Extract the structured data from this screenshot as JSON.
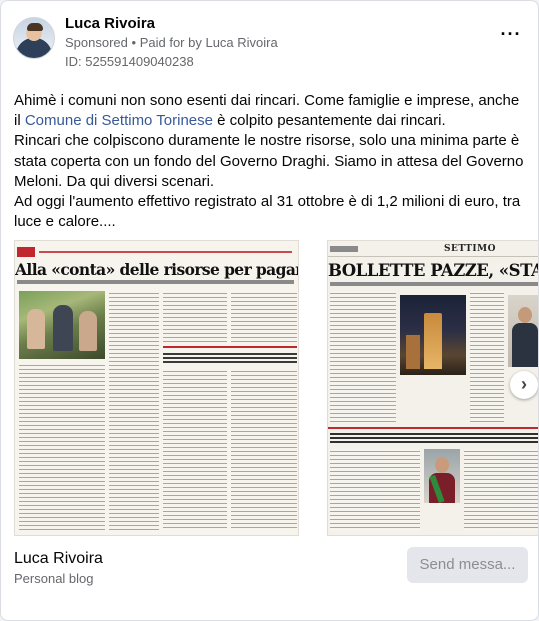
{
  "post": {
    "page_name": "Luca Rivoira",
    "sponsored_label": "Sponsored",
    "separator": "•",
    "paid_for_label": "Paid for by Luca Rivoira",
    "library_id": "ID: 525591409040238",
    "more_icon": "more-horizontal-icon",
    "body": {
      "part1": "Ahimè i comuni non sono esenti dai rincari. Come famiglie e imprese, anche il ",
      "link": "Comune di Settimo Torinese",
      "part2": " è colpito pesantemente dai rincari.",
      "line2": "Rincari che colpiscono duramente le nostre risorse, solo una minima parte è stata coperta con un fondo del Governo Draghi. Siamo in attesa del Governo Meloni. Da qui diversi scenari.",
      "line3": "Ad oggi l'aumento effettivo registrato al 31 ottobre è di 1,2 milioni di euro, tra luce e calore...."
    }
  },
  "carousel": {
    "card1_headline": "Alla «conta» delle risorse per pagare le utenze",
    "card2_section": "SETTIMO",
    "card2_headline": "BOLLETTE PAZZE, «STANGATA» PER IL",
    "next_icon": "chevron-right-icon",
    "next_glyph": "›"
  },
  "footer": {
    "page_name": "Luca Rivoira",
    "category": "Personal blog",
    "send_button": "Send messa..."
  },
  "colors": {
    "link": "#385898",
    "secondary_text": "#65676b",
    "button_bg": "#e4e6eb",
    "newspaper_red": "#c0282d"
  }
}
